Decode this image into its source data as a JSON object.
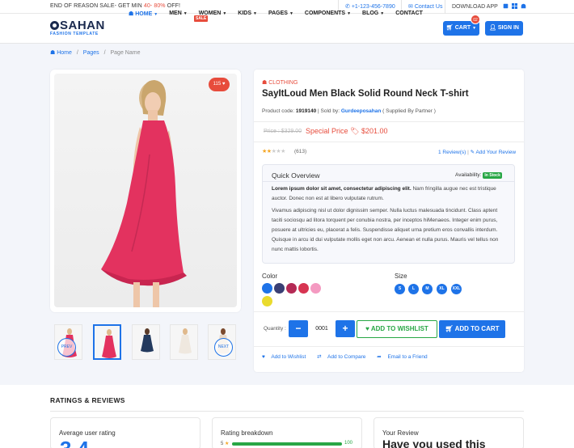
{
  "topbar": {
    "promo_prefix": "END OF REASON SALE- GET MIN ",
    "promo_highlight": "40- 80%",
    "promo_suffix": " OFF!",
    "phone": "+1-123-456-7890",
    "contact": "Contact Us",
    "download": "DOWNLOAD APP"
  },
  "header": {
    "logo_name": "SAHAN",
    "logo_sub": "FASHION TEMPLATE",
    "nav": [
      "HOME",
      "MEN",
      "WOMEN",
      "KIDS",
      "PAGES",
      "COMPONENTS",
      "BLOG",
      "CONTACT"
    ],
    "sale_tag": "SALE",
    "cart_label": "CART",
    "cart_count": "02",
    "signin_label": "SIGN IN"
  },
  "breadcrumb": {
    "home": "Home",
    "sep1": "/",
    "pages": "Pages",
    "sep2": "/",
    "current": "Page Name"
  },
  "gallery": {
    "like_count": "115",
    "prev_label": "PREV",
    "next_label": "NEXT"
  },
  "product": {
    "category": "CLOTHING",
    "title": "SayItLoud Men Black Solid Round Neck T-shirt",
    "code_label": "Product code:",
    "code_value": "1919140",
    "sold_by_label": "| Sold by:",
    "seller": "Gurdeeposahan",
    "supplied": "( Supplied By Partner )",
    "price_old": "Price : $329.00",
    "special_label": "Special Price",
    "special_price": "$201.00",
    "rating": 2,
    "rating_count": "(613)",
    "reviews_link": "1 Review(s)",
    "add_review": "Add Your Review"
  },
  "overview": {
    "title": "Quick Overview",
    "availability_label": "Availability:",
    "availability": "In Stock",
    "p1_bold": "Lorem ipsum dolor sit amet, consectetur adipiscing elit.",
    "p1_rest": " Nam fringilla augue nec est tristique auctor. Donec non est at libero vulputate rutrum.",
    "p2": "Vivamus adipiscing nisl ut dolor dignissim semper. Nulla luctus malesuada tincidunt. Class aptent taciti sociosqu ad litora torquent per conubia nostra, per inceptos hiMenaeos. Integer enim purus, posuere at ultricies eu, placerat a felis. Suspendisse aliquet urna pretium eros convallis interdum. Quisque in arcu id dui vulputate mollis eget non arcu. Aenean et nulla purus. Mauris vel tellus non nunc mattis lobortis."
  },
  "options": {
    "color_label": "Color",
    "colors": [
      "#1e73e8",
      "#3a3f74",
      "#b42a55",
      "#d73451",
      "#f49ac1",
      "#eadb2d"
    ],
    "size_label": "Size",
    "sizes": [
      "S",
      "L",
      "M",
      "XL",
      "XXL"
    ]
  },
  "actions": {
    "qty_label": "Quantity :",
    "qty_value": "0001",
    "minus": "−",
    "plus": "+",
    "wishlist": "ADD TO WISHLIST",
    "add_cart": "ADD TO CART",
    "link_wishlist": "Add to Wishlist",
    "link_compare": "Add to Compare",
    "link_email": "Email to a Friend"
  },
  "reviews": {
    "title": "RATINGS & REVIEWS",
    "avg_title": "Average user rating",
    "avg_value": "3.4",
    "breakdown_title": "Rating breakdown",
    "bar_label": "5",
    "bar_value": "100",
    "bar_fill": 1.0,
    "your_title": "Your Review",
    "your_heading": "Have you used this"
  }
}
